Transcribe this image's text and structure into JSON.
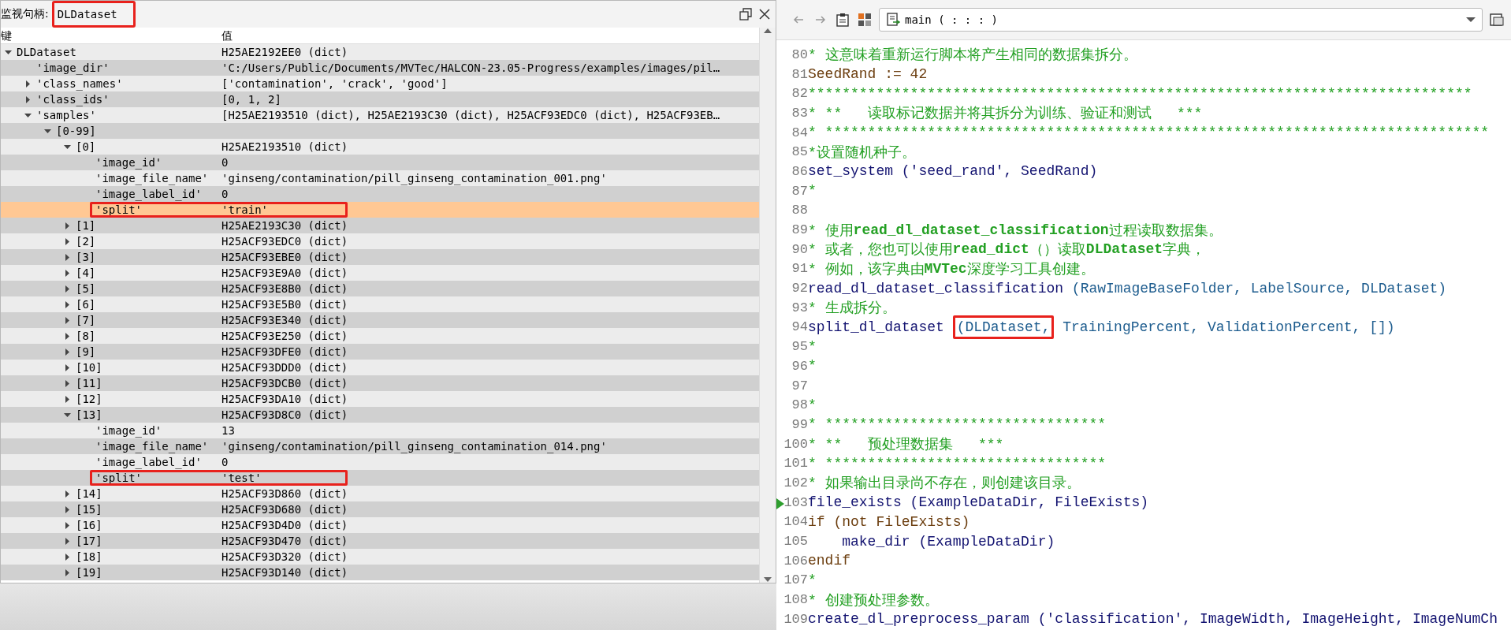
{
  "watch": {
    "title_label": "监视句柄:",
    "title_value": "DLDataset",
    "title_boxed": true,
    "columns": [
      "键",
      "值"
    ],
    "tree": [
      {
        "key": "DLDataset",
        "value": "H25AE2192EE0 (dict)",
        "expanded": true,
        "selected": false,
        "children": [
          {
            "key": "'image_dir'",
            "value": "'C:/Users/Public/Documents/MVTec/HALCON-23.05-Progress/examples/images/pil…",
            "selected": false
          },
          {
            "key": "'class_names'",
            "value": "['contamination', 'crack', 'good']",
            "expanded": false,
            "selected": false
          },
          {
            "key": "'class_ids'",
            "value": "[0, 1, 2]",
            "expanded": false,
            "selected": false
          },
          {
            "key": "'samples'",
            "value": "[H25AE2193510 (dict), H25AE2193C30 (dict), H25ACF93EDC0 (dict), H25ACF93EB…",
            "expanded": true,
            "selected": false,
            "children": [
              {
                "key": "[0-99]",
                "expanded": true,
                "selected": false,
                "children": [
                  {
                    "key": "[0]",
                    "value": "H25AE2193510 (dict)",
                    "expanded": true,
                    "selected": false,
                    "children": [
                      {
                        "key": "'image_id'",
                        "value": "0",
                        "selected": false
                      },
                      {
                        "key": "'image_file_name'",
                        "value": "'ginseng/contamination/pill_ginseng_contamination_001.png'",
                        "selected": false
                      },
                      {
                        "key": "'image_label_id'",
                        "value": "0",
                        "selected": false
                      },
                      {
                        "key": "'split'",
                        "value": "'train'",
                        "selected": true,
                        "boxed": true
                      }
                    ]
                  },
                  {
                    "key": "[1]",
                    "value": "H25AE2193C30 (dict)",
                    "expanded": false,
                    "selected": false
                  },
                  {
                    "key": "[2]",
                    "value": "H25ACF93EDC0 (dict)",
                    "expanded": false,
                    "selected": false
                  },
                  {
                    "key": "[3]",
                    "value": "H25ACF93EBE0 (dict)",
                    "expanded": false,
                    "selected": false
                  },
                  {
                    "key": "[4]",
                    "value": "H25ACF93E9A0 (dict)",
                    "expanded": false,
                    "selected": false
                  },
                  {
                    "key": "[5]",
                    "value": "H25ACF93E8B0 (dict)",
                    "expanded": false,
                    "selected": false
                  },
                  {
                    "key": "[6]",
                    "value": "H25ACF93E5B0 (dict)",
                    "expanded": false,
                    "selected": false
                  },
                  {
                    "key": "[7]",
                    "value": "H25ACF93E340 (dict)",
                    "expanded": false,
                    "selected": false
                  },
                  {
                    "key": "[8]",
                    "value": "H25ACF93E250 (dict)",
                    "expanded": false,
                    "selected": false
                  },
                  {
                    "key": "[9]",
                    "value": "H25ACF93DFE0 (dict)",
                    "expanded": false,
                    "selected": false
                  },
                  {
                    "key": "[10]",
                    "value": "H25ACF93DDD0 (dict)",
                    "expanded": false,
                    "selected": false
                  },
                  {
                    "key": "[11]",
                    "value": "H25ACF93DCB0 (dict)",
                    "expanded": false,
                    "selected": false
                  },
                  {
                    "key": "[12]",
                    "value": "H25ACF93DA10 (dict)",
                    "expanded": false,
                    "selected": false
                  },
                  {
                    "key": "[13]",
                    "value": "H25ACF93D8C0 (dict)",
                    "expanded": true,
                    "selected": false,
                    "children": [
                      {
                        "key": "'image_id'",
                        "value": "13",
                        "selected": false
                      },
                      {
                        "key": "'image_file_name'",
                        "value": "'ginseng/contamination/pill_ginseng_contamination_014.png'",
                        "selected": false
                      },
                      {
                        "key": "'image_label_id'",
                        "value": "0",
                        "selected": false
                      },
                      {
                        "key": "'split'",
                        "value": "'test'",
                        "selected": false,
                        "boxed": true
                      }
                    ]
                  },
                  {
                    "key": "[14]",
                    "value": "H25ACF93D860 (dict)",
                    "expanded": false,
                    "selected": false
                  },
                  {
                    "key": "[15]",
                    "value": "H25ACF93D680 (dict)",
                    "expanded": false,
                    "selected": false
                  },
                  {
                    "key": "[16]",
                    "value": "H25ACF93D4D0 (dict)",
                    "expanded": false,
                    "selected": false
                  },
                  {
                    "key": "[17]",
                    "value": "H25ACF93D470 (dict)",
                    "expanded": false,
                    "selected": false
                  },
                  {
                    "key": "[18]",
                    "value": "H25ACF93D320 (dict)",
                    "expanded": false,
                    "selected": false
                  },
                  {
                    "key": "[19]",
                    "value": "H25ACF93D140 (dict)",
                    "expanded": false,
                    "selected": false
                  }
                ]
              }
            ]
          }
        ]
      }
    ]
  },
  "editor": {
    "procedure": "main ( : : : )",
    "lines": [
      {
        "number": "80",
        "segments": [
          {
            "kind": "comment",
            "text": "* 这意味着重新运行脚本将产生相同的数据集拆分。"
          }
        ]
      },
      {
        "number": "81",
        "segments": [
          {
            "kind": "assign",
            "text": "SeedRand := 42"
          }
        ]
      },
      {
        "number": "82",
        "segments": [
          {
            "kind": "comment",
            "text": "******************************************************************************"
          }
        ]
      },
      {
        "number": "83",
        "segments": [
          {
            "kind": "comment",
            "text": "* **   读取标记数据并将其拆分为训练、验证和测试   ***"
          }
        ]
      },
      {
        "number": "84",
        "segments": [
          {
            "kind": "comment",
            "text": "* ******************************************************************************"
          }
        ]
      },
      {
        "number": "85",
        "segments": [
          {
            "kind": "comment",
            "text": "*设置随机种子。"
          }
        ]
      },
      {
        "number": "86",
        "segments": [
          {
            "kind": "operator",
            "text": "set_system ('seed_rand', SeedRand)"
          }
        ]
      },
      {
        "number": "87",
        "segments": [
          {
            "kind": "comment",
            "text": "*"
          }
        ]
      },
      {
        "number": "88"
      },
      {
        "number": "89",
        "segments": [
          {
            "kind": "comment",
            "text": "* 使用"
          },
          {
            "kind": "comment",
            "text": "read_dl_dataset_classification",
            "bold": true
          },
          {
            "kind": "comment",
            "text": "过程读取数据集。"
          }
        ]
      },
      {
        "number": "90",
        "segments": [
          {
            "kind": "comment",
            "text": "* 或者，您也可以使用"
          },
          {
            "kind": "comment",
            "text": "read_dict",
            "bold": true
          },
          {
            "kind": "comment",
            "text": "（）读取"
          },
          {
            "kind": "comment",
            "text": "DLDataset",
            "bold": true
          },
          {
            "kind": "comment",
            "text": "字典，"
          }
        ]
      },
      {
        "number": "91",
        "segments": [
          {
            "kind": "comment",
            "text": "* 例如，该字典由"
          },
          {
            "kind": "comment",
            "text": "MVTec",
            "bold": true
          },
          {
            "kind": "comment",
            "text": "深度学习工具创建。"
          }
        ]
      },
      {
        "number": "92",
        "segments": [
          {
            "kind": "operator",
            "text": "read_dl_dataset_classification "
          },
          {
            "kind": "params",
            "text": "(RawImageBaseFolder, LabelSource, DLDataset)"
          }
        ]
      },
      {
        "number": "93",
        "segments": [
          {
            "kind": "comment",
            "text": "* 生成拆分。"
          }
        ]
      },
      {
        "number": "94",
        "segments": [
          {
            "kind": "operator",
            "text": "split_dl_dataset "
          },
          {
            "kind": "params",
            "text": "(DLDataset,",
            "boxed": true
          },
          {
            "kind": "params",
            "text": " TrainingPercent, ValidationPercent, [])"
          }
        ]
      },
      {
        "number": "95",
        "segments": [
          {
            "kind": "comment",
            "text": "*"
          }
        ]
      },
      {
        "number": "96",
        "segments": [
          {
            "kind": "comment",
            "text": "*"
          }
        ]
      },
      {
        "number": "97"
      },
      {
        "number": "98",
        "segments": [
          {
            "kind": "comment",
            "text": "*"
          }
        ]
      },
      {
        "number": "99",
        "segments": [
          {
            "kind": "comment",
            "text": "* *********************************"
          }
        ]
      },
      {
        "number": "100",
        "segments": [
          {
            "kind": "comment",
            "text": "* **   预处理数据集   ***"
          }
        ]
      },
      {
        "number": "101",
        "segments": [
          {
            "kind": "comment",
            "text": "* *********************************"
          }
        ]
      },
      {
        "number": "102",
        "segments": [
          {
            "kind": "comment",
            "text": "* 如果输出目录尚不存在，则创建该目录。"
          }
        ]
      },
      {
        "number": "103",
        "current": true,
        "segments": [
          {
            "kind": "operator",
            "text": "file_exists (ExampleDataDir, FileExists)"
          }
        ]
      },
      {
        "number": "104",
        "segments": [
          {
            "kind": "control",
            "text": "if (not FileExists)"
          }
        ]
      },
      {
        "number": "105",
        "segments": [
          {
            "kind": "operator",
            "text": "    make_dir (ExampleDataDir)"
          }
        ]
      },
      {
        "number": "106",
        "segments": [
          {
            "kind": "control",
            "text": "endif"
          }
        ]
      },
      {
        "number": "107",
        "segments": [
          {
            "kind": "comment",
            "text": "*"
          }
        ]
      },
      {
        "number": "108",
        "segments": [
          {
            "kind": "comment",
            "text": "* 创建预处理参数。"
          }
        ]
      },
      {
        "number": "109",
        "segments": [
          {
            "kind": "operator",
            "text": "create_dl_preprocess_param ('classification', ImageWidth, ImageHeight, ImageNumCh"
          }
        ]
      }
    ]
  }
}
